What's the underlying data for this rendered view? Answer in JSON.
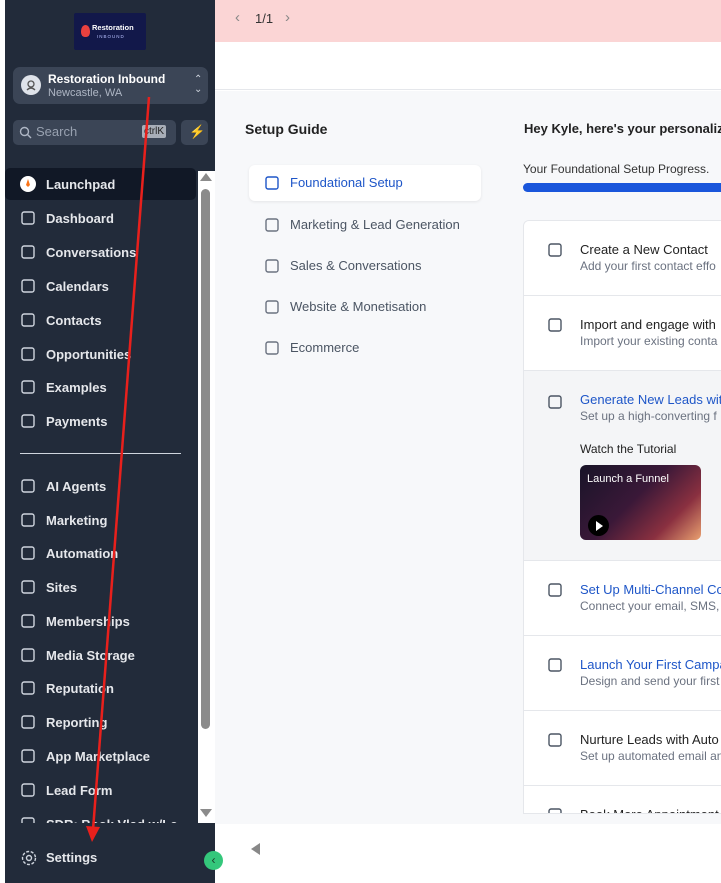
{
  "sidebar": {
    "logo": {
      "line1": "Restoration",
      "line2": "INBOUND"
    },
    "account": {
      "name": "Restoration Inbound",
      "location": "Newcastle, WA"
    },
    "search": {
      "placeholder": "Search",
      "shortcut": "ctrlK"
    },
    "items": [
      {
        "label": "Launchpad",
        "icon": "rocket-icon"
      },
      {
        "label": "Dashboard",
        "icon": "grid-icon"
      },
      {
        "label": "Conversations",
        "icon": "chat-bubble-icon"
      },
      {
        "label": "Calendars",
        "icon": "calendar-icon"
      },
      {
        "label": "Contacts",
        "icon": "contact-book-icon"
      },
      {
        "label": "Opportunities",
        "icon": "network-icon"
      },
      {
        "label": "Examples",
        "icon": "cube-icon"
      },
      {
        "label": "Payments",
        "icon": "receipt-icon"
      },
      {
        "label": "AI Agents",
        "icon": "sparkle-icon"
      },
      {
        "label": "Marketing",
        "icon": "paper-plane-icon"
      },
      {
        "label": "Automation",
        "icon": "automation-icon"
      },
      {
        "label": "Sites",
        "icon": "globe-window-icon"
      },
      {
        "label": "Memberships",
        "icon": "award-icon"
      },
      {
        "label": "Media Storage",
        "icon": "image-icon"
      },
      {
        "label": "Reputation",
        "icon": "star-icon"
      },
      {
        "label": "Reporting",
        "icon": "trend-up-icon"
      },
      {
        "label": "App Marketplace",
        "icon": "apps-grid-icon"
      },
      {
        "label": "Lead Form",
        "icon": "funnel-icon"
      },
      {
        "label": "SDR: Book Vlad w/Le",
        "icon": "calendar-icon"
      }
    ],
    "settings_label": "Settings"
  },
  "banner": {
    "page": "1/1"
  },
  "guide": {
    "title": "Setup Guide",
    "items": [
      {
        "label": "Foundational Setup",
        "icon": "sun-gear-icon"
      },
      {
        "label": "Marketing & Lead Generation",
        "icon": "paper-plane-icon"
      },
      {
        "label": "Sales & Conversations",
        "icon": "chart-circle-icon"
      },
      {
        "label": "Website & Monetisation",
        "icon": "globe-icon"
      },
      {
        "label": "Ecommerce",
        "icon": "cart-icon"
      }
    ]
  },
  "content": {
    "greeting": "Hey Kyle, here's your personaliz",
    "progress_label": "Your Foundational Setup Progress.",
    "cards": [
      {
        "title": "Create a New Contact",
        "desc": "Add your first contact effo",
        "icon": "user-plus-icon"
      },
      {
        "title": "Import and engage with",
        "desc": "Import your existing conta",
        "icon": "user-import-icon"
      },
      {
        "title": "Generate New Leads wit",
        "desc": "Set up a high-converting f",
        "icon": "funnel-icon",
        "watch": "Watch the Tutorial",
        "video_title": "Launch a Funnel"
      },
      {
        "title": "Set Up Multi-Channel Co",
        "desc": "Connect your email, SMS, a",
        "icon": "chat-icon"
      },
      {
        "title": "Launch Your First Campa",
        "desc": "Design and send your first",
        "icon": "envelope-icon"
      },
      {
        "title": "Nurture Leads with Auto",
        "desc": "Set up automated email an",
        "icon": "megaphone-icon"
      },
      {
        "title": "Book More Appointment",
        "desc": "",
        "icon": "calendar-icon"
      }
    ]
  },
  "colors": {
    "sidebar": "#222b3a",
    "accent": "#1a56db",
    "banner": "#fbd5d5",
    "annotation": "#e8201c"
  }
}
